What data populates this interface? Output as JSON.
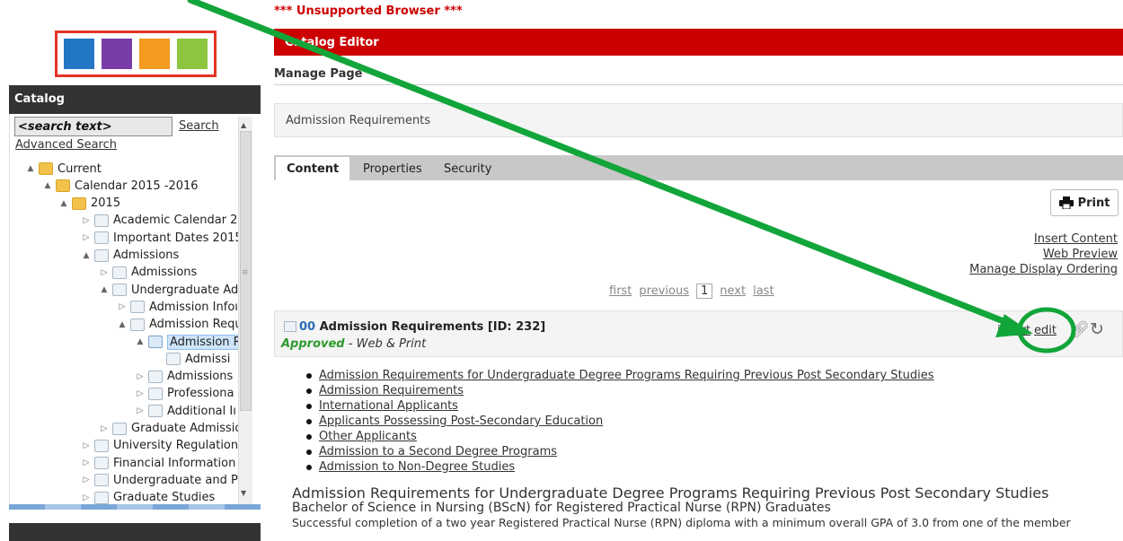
{
  "browser_warning": "*** Unsupported Browser ***",
  "logo": {
    "colors": [
      "#2376c4",
      "#7a3da8",
      "#f39a1f",
      "#8cc63e"
    ]
  },
  "catalog": {
    "title": "Catalog",
    "search_placeholder": "<search text>",
    "search_button": "Search",
    "advanced_search": "Advanced Search",
    "tree": [
      {
        "label": "Current",
        "icon": "folder-open-icon",
        "toggle": "▲"
      },
      {
        "label": "Calendar 2015 -2016",
        "icon": "folder-open-icon",
        "toggle": "▲"
      },
      {
        "label": "2015",
        "icon": "folder-open-icon",
        "toggle": "▲"
      },
      {
        "label": "Academic Calendar 20:",
        "icon": "page-icon",
        "toggle": "▷"
      },
      {
        "label": "Important Dates 2015",
        "icon": "page-icon",
        "toggle": "▷"
      },
      {
        "label": "Admissions",
        "icon": "page-icon",
        "toggle": "▲"
      },
      {
        "label": "Admissions",
        "icon": "page-icon",
        "toggle": "▷"
      },
      {
        "label": "Undergraduate Adı",
        "icon": "page-icon",
        "toggle": "▲"
      },
      {
        "label": "Admission Infoı",
        "icon": "page-icon",
        "toggle": "▷"
      },
      {
        "label": "Admission Requ",
        "icon": "page-icon",
        "toggle": "▲"
      },
      {
        "label": "Admission R",
        "icon": "page-icon",
        "toggle": "▲"
      },
      {
        "label": "Admissi",
        "icon": "page-icon",
        "toggle": ""
      },
      {
        "label": "Admissions",
        "icon": "page-icon",
        "toggle": "▷"
      },
      {
        "label": "Professiona",
        "icon": "page-icon",
        "toggle": "▷"
      },
      {
        "label": "Additional Iı",
        "icon": "page-icon",
        "toggle": "▷"
      },
      {
        "label": "Graduate Admissio",
        "icon": "page-icon",
        "toggle": "▷"
      },
      {
        "label": "University Regulations",
        "icon": "page-icon",
        "toggle": "▷"
      },
      {
        "label": "Financial Information",
        "icon": "page-icon",
        "toggle": "▷"
      },
      {
        "label": "Undergraduate and Pro",
        "icon": "page-icon",
        "toggle": "▷"
      },
      {
        "label": "Graduate Studies",
        "icon": "page-icon",
        "toggle": "▷"
      }
    ]
  },
  "editor": {
    "bar_title": "Catalog Editor",
    "manage_page": "Manage Page",
    "page_title": "Admission Requirements",
    "tabs": [
      "Content",
      "Properties",
      "Security"
    ],
    "print": "Print",
    "actions": [
      "Insert Content",
      "Web Preview",
      "Manage Display Ordering"
    ],
    "pager": {
      "first": "first",
      "previous": "previous",
      "current": "1",
      "next": "next",
      "last": "last"
    }
  },
  "item": {
    "number": "00",
    "title": "Admission Requirements",
    "id": "[ID: 232]",
    "status": "Approved",
    "status_suffix": "- Web & Print",
    "insert": "insert",
    "edit": "edit",
    "status_color": "#2e9a2e"
  },
  "content": {
    "links": [
      "Admission Requirements for Undergraduate Degree Programs Requiring Previous Post Secondary Studies",
      "Admission Requirements",
      "International Applicants",
      "Applicants Possessing Post-Secondary Education",
      "Other Applicants",
      "Admission to a Second Degree Programs",
      "Admission to Non-Degree Studies"
    ],
    "heading": "Admission Requirements for Undergraduate Degree Programs Requiring Previous Post Secondary Studies",
    "subheading": "Bachelor of Science in Nursing (BScN) for Registered Practical Nurse (RPN) Graduates",
    "paragraph": "Successful completion of a two year Registered Practical Nurse (RPN) diploma with a minimum overall GPA of 3.0 from one of the member"
  },
  "annotation": {
    "color": "#12a53a"
  }
}
